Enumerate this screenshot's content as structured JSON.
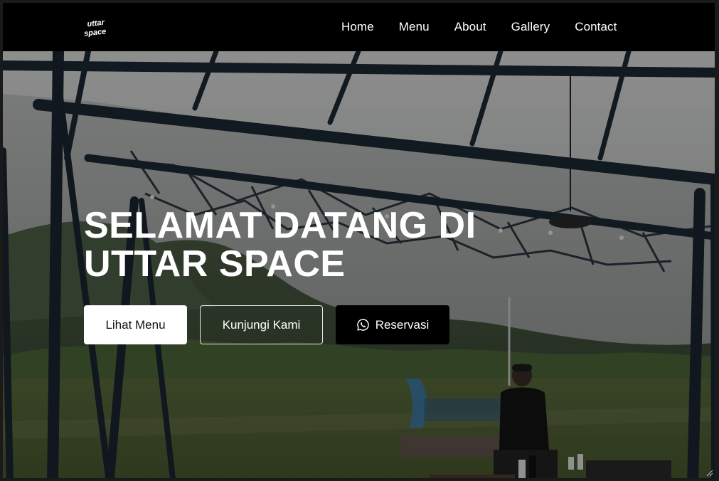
{
  "brand": {
    "logo_text_line1": "uttar",
    "logo_text_line2": "space",
    "logo_icon": "uttar-space-logo"
  },
  "nav": {
    "items": [
      {
        "label": "Home"
      },
      {
        "label": "Menu"
      },
      {
        "label": "About"
      },
      {
        "label": "Gallery"
      },
      {
        "label": "Contact"
      }
    ]
  },
  "hero": {
    "title_line1": "SELAMAT DATANG DI",
    "title_line2": "UTTAR SPACE",
    "background_icon": "outdoor-cafe-photo",
    "buttons": {
      "menu": "Lihat Menu",
      "visit": "Kunjungi Kami",
      "reserve": "Reservasi",
      "reserve_icon": "whatsapp-icon"
    }
  },
  "colors": {
    "navbar_bg": "#000000",
    "text": "#ffffff",
    "primary_btn_bg": "#ffffff",
    "dark_btn_bg": "#000000"
  }
}
